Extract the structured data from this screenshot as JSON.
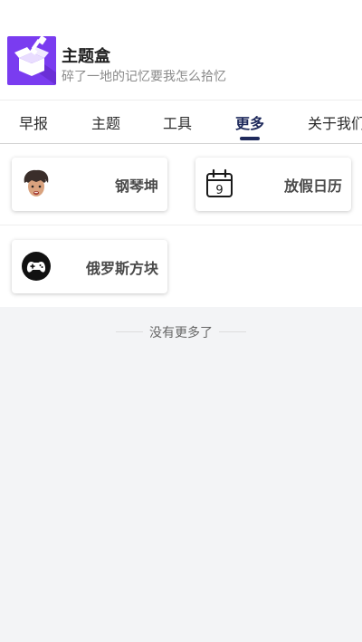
{
  "header": {
    "title": "主题盒",
    "subtitle": "碎了一地的记忆要我怎么拾忆",
    "logo_color": "#7a3cf0"
  },
  "tabs": [
    {
      "label": "早报",
      "active": false
    },
    {
      "label": "主题",
      "active": false
    },
    {
      "label": "工具",
      "active": false
    },
    {
      "label": "更多",
      "active": true
    },
    {
      "label": "关于我们",
      "active": false
    }
  ],
  "accent_color": "#1f2a5c",
  "cards": [
    {
      "label": "钢琴坤",
      "icon": "avatar-icon"
    },
    {
      "label": "放假日历",
      "icon": "calendar-icon",
      "icon_text": "9"
    },
    {
      "label": "俄罗斯方块",
      "icon": "gamepad-icon"
    }
  ],
  "footer": {
    "end_text": "没有更多了"
  }
}
